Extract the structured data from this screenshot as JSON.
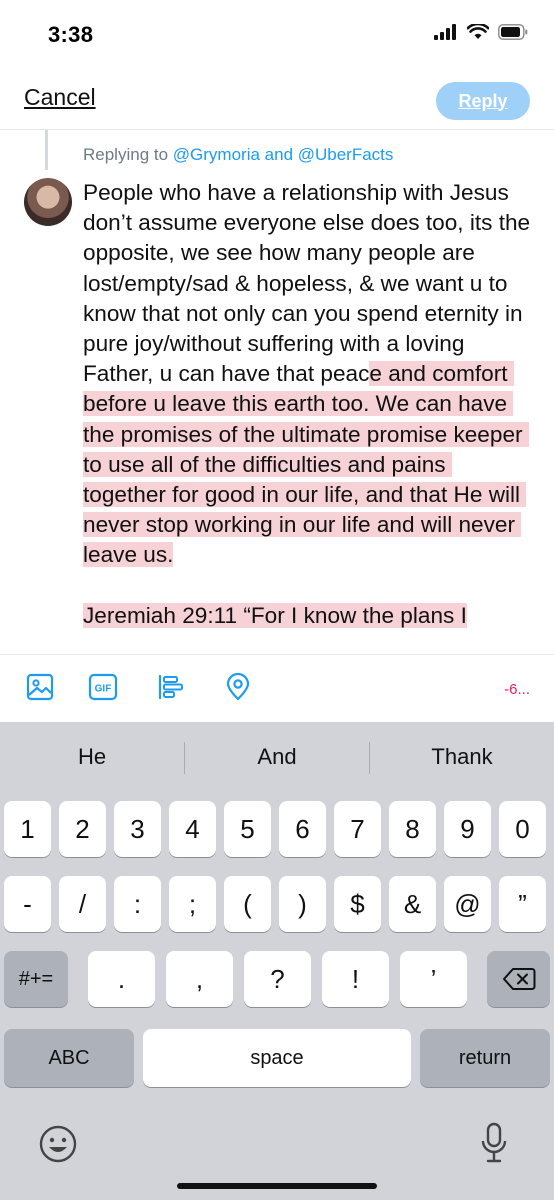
{
  "status_bar": {
    "time": "3:38"
  },
  "header": {
    "cancel_label": "Cancel",
    "reply_label": "Reply"
  },
  "compose": {
    "replying_prefix": "Replying to ",
    "replying_handles": "@Grymoria and @UberFacts",
    "text_within_limit": "People who have a relationship with Jesus don’t assume everyone else does too, its the opposite, we see how many people are lost/empty/sad & hopeless, & we want u to know that not only can you spend eternity in pure joy/without suffering with a loving Father, u can have that peac",
    "text_over_limit": "e and comfort before u leave this earth too. We can have the promises of the ultimate promise keeper to use all of the difficulties and pains together for good in our life, and that He will never stop working in our life and will never leave us.\n\nJeremiah 29:11 “For I know the plans I"
  },
  "toolbar": {
    "icons": [
      "image-icon",
      "gif-icon",
      "poll-icon",
      "location-icon"
    ],
    "gif_label": "GIF",
    "char_count": "-6..."
  },
  "keyboard": {
    "suggestions": [
      "He",
      "And",
      "Thank"
    ],
    "row1": [
      "1",
      "2",
      "3",
      "4",
      "5",
      "6",
      "7",
      "8",
      "9",
      "0"
    ],
    "row2": [
      "-",
      "/",
      ":",
      ";",
      "(",
      ")",
      "$",
      "&",
      "@",
      "”"
    ],
    "row3_mode": "#+=",
    "row3": [
      ".",
      ",",
      "?",
      "!",
      "’"
    ],
    "abc_label": "ABC",
    "space_label": "space",
    "return_label": "return"
  },
  "colors": {
    "accent": "#1d9bf0",
    "reply_disabled": "#9fd0f7",
    "over_limit_highlight": "#f6d2d6",
    "count_negative": "#e0245e"
  }
}
